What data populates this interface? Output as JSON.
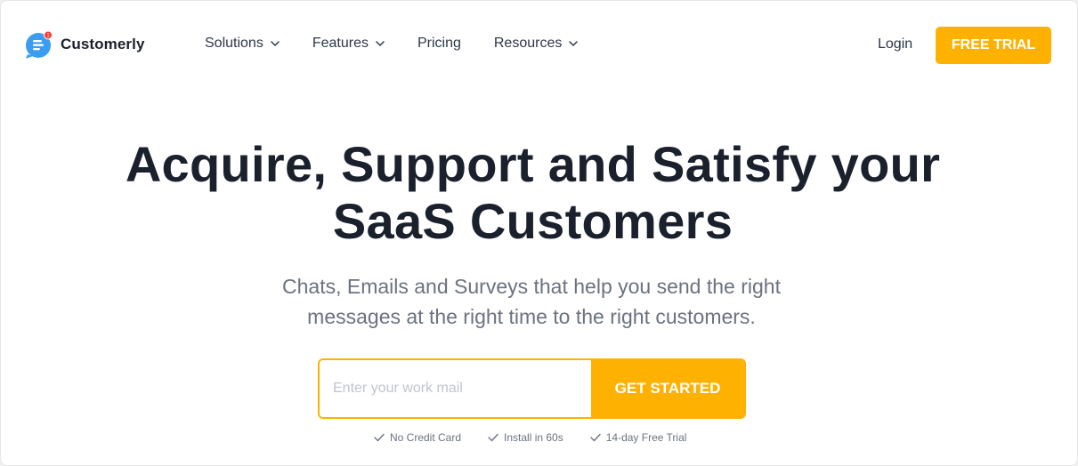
{
  "brand": {
    "name": "Customerly",
    "logo_icon": "chat-bubble-icon",
    "notification_badge": "1",
    "accent_color": "#ffb100",
    "logo_color": "#3b9df0"
  },
  "nav": {
    "items": [
      {
        "label": "Solutions",
        "has_dropdown": true
      },
      {
        "label": "Features",
        "has_dropdown": true
      },
      {
        "label": "Pricing",
        "has_dropdown": false
      },
      {
        "label": "Resources",
        "has_dropdown": true
      }
    ],
    "login_label": "Login",
    "cta_label": "FREE TRIAL"
  },
  "hero": {
    "title_line1": "Acquire, Support and Satisfy your",
    "title_line2": "SaaS Customers",
    "subtitle_line1": "Chats, Emails and Surveys that help you send the right",
    "subtitle_line2": "messages at the right time to the right customers.",
    "email_placeholder": "Enter your work mail",
    "email_value": "",
    "submit_label": "GET STARTED",
    "perks": [
      {
        "icon": "check-icon",
        "label": "No Credit Card"
      },
      {
        "icon": "check-icon",
        "label": "Install in 60s"
      },
      {
        "icon": "check-icon",
        "label": "14-day Free Trial"
      }
    ]
  }
}
